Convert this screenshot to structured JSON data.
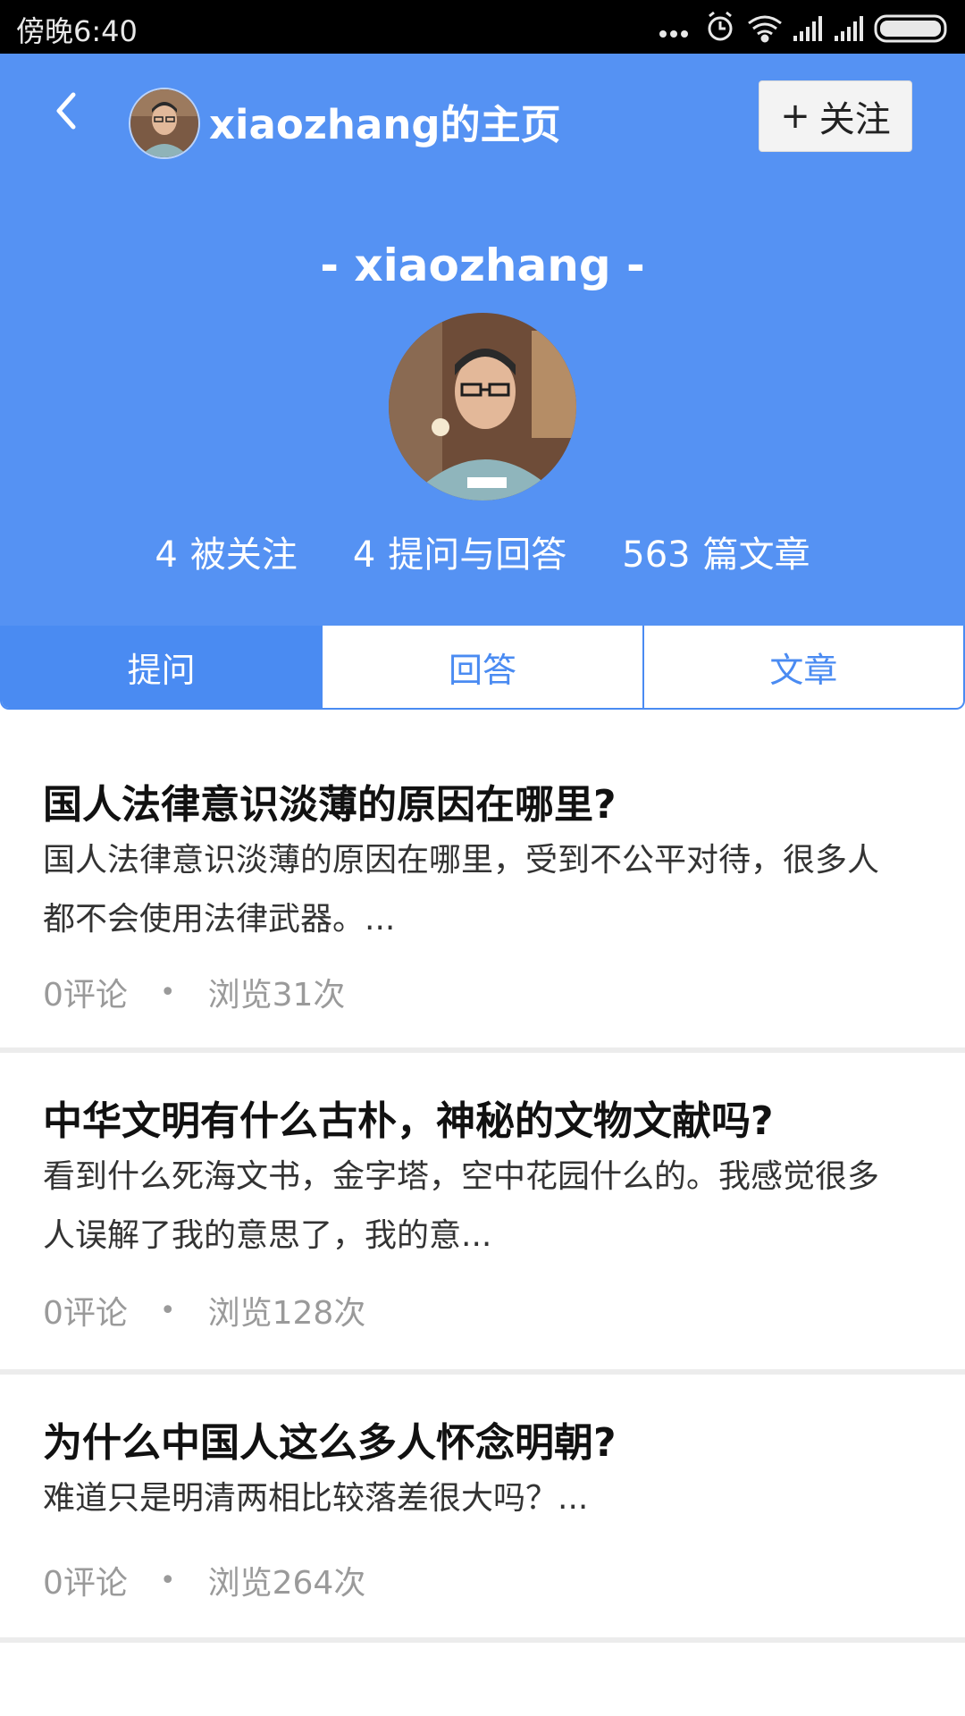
{
  "status_bar": {
    "time": "傍晚6:40",
    "icons": [
      "more-dots-icon",
      "alarm-icon",
      "wifi-icon",
      "signal-icon",
      "signal-icon",
      "battery-icon"
    ]
  },
  "header": {
    "title": "xiaozhang的主页",
    "follow_label": "关注",
    "follow_icon": "plus-icon"
  },
  "profile": {
    "name": "- xiaozhang -",
    "stats": [
      {
        "num": "4",
        "label": "被关注"
      },
      {
        "num": "4",
        "label": "提问与回答"
      },
      {
        "num": "563",
        "label": "篇文章"
      }
    ]
  },
  "tabs": [
    {
      "label": "提问",
      "active": true
    },
    {
      "label": "回答",
      "active": false
    },
    {
      "label": "文章",
      "active": false
    }
  ],
  "questions": [
    {
      "title": "国人法律意识淡薄的原因在哪里?",
      "desc": "国人法律意识淡薄的原因在哪里，受到不公平对待，很多人都不会使用法律武器。...",
      "comments": "0评论",
      "views": "浏览31次"
    },
    {
      "title": "中华文明有什么古朴，神秘的文物文献吗?",
      "desc": "看到什么死海文书，金字塔，空中花园什么的。我感觉很多人误解了我的意思了，我的意...",
      "comments": "0评论",
      "views": "浏览128次"
    },
    {
      "title": "为什么中国人这么多人怀念明朝?",
      "desc": "难道只是明清两相比较落差很大吗？...",
      "comments": "0评论",
      "views": "浏览264次"
    }
  ],
  "colors": {
    "brand_blue": "#5592f3",
    "tab_blue": "#4a8bf2",
    "meta_gray": "#9a9a9a"
  }
}
